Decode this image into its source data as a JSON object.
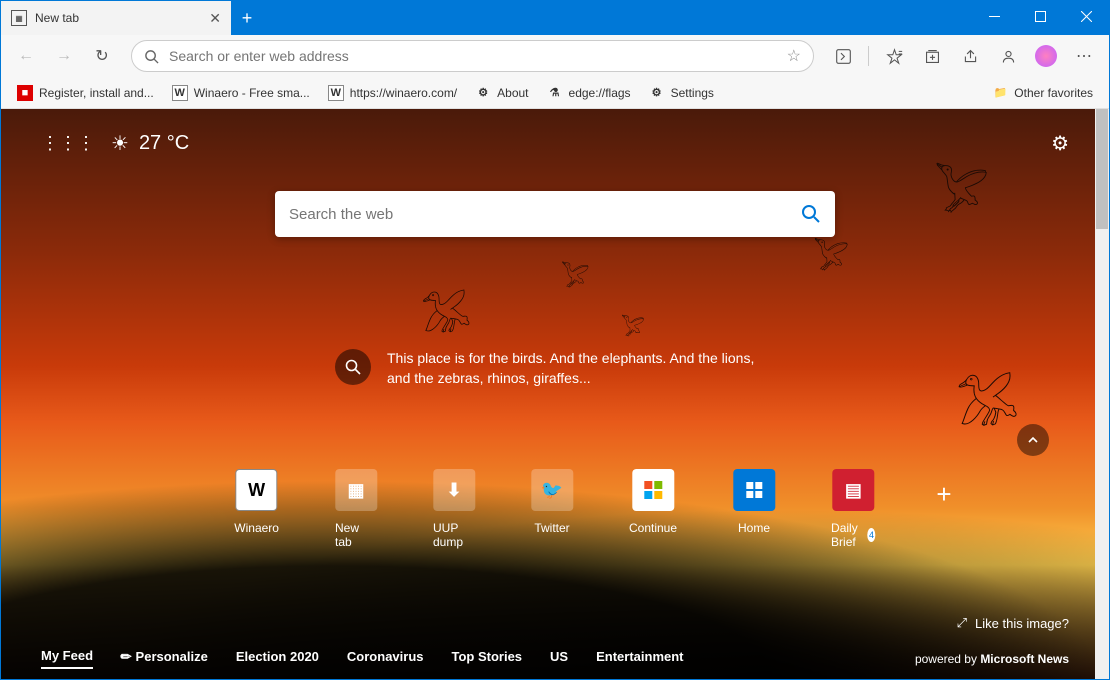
{
  "window": {
    "tab_title": "New tab"
  },
  "omnibox": {
    "placeholder": "Search or enter web address"
  },
  "bookmarks": {
    "items": [
      {
        "label": "Register, install and..."
      },
      {
        "label": "Winaero - Free sma..."
      },
      {
        "label": "https://winaero.com/"
      },
      {
        "label": "About"
      },
      {
        "label": "edge://flags"
      },
      {
        "label": "Settings"
      }
    ],
    "other": "Other favorites"
  },
  "ntp": {
    "temperature": "27 °C",
    "search_placeholder": "Search the web",
    "hint_text": "This place is for the birds. And the elephants. And the lions, and the zebras, rhinos, giraffes...",
    "tiles": [
      {
        "label": "Winaero"
      },
      {
        "label": "New tab"
      },
      {
        "label": "UUP dump"
      },
      {
        "label": "Twitter"
      },
      {
        "label": "Continue"
      },
      {
        "label": "Home"
      },
      {
        "label": "Daily Brief",
        "badge": "4"
      }
    ],
    "like_image": "Like this image?",
    "feed": {
      "items": [
        "My Feed",
        "Personalize",
        "Election 2020",
        "Coronavirus",
        "Top Stories",
        "US",
        "Entertainment"
      ],
      "powered_prefix": "powered by ",
      "powered_brand": "Microsoft News"
    }
  }
}
